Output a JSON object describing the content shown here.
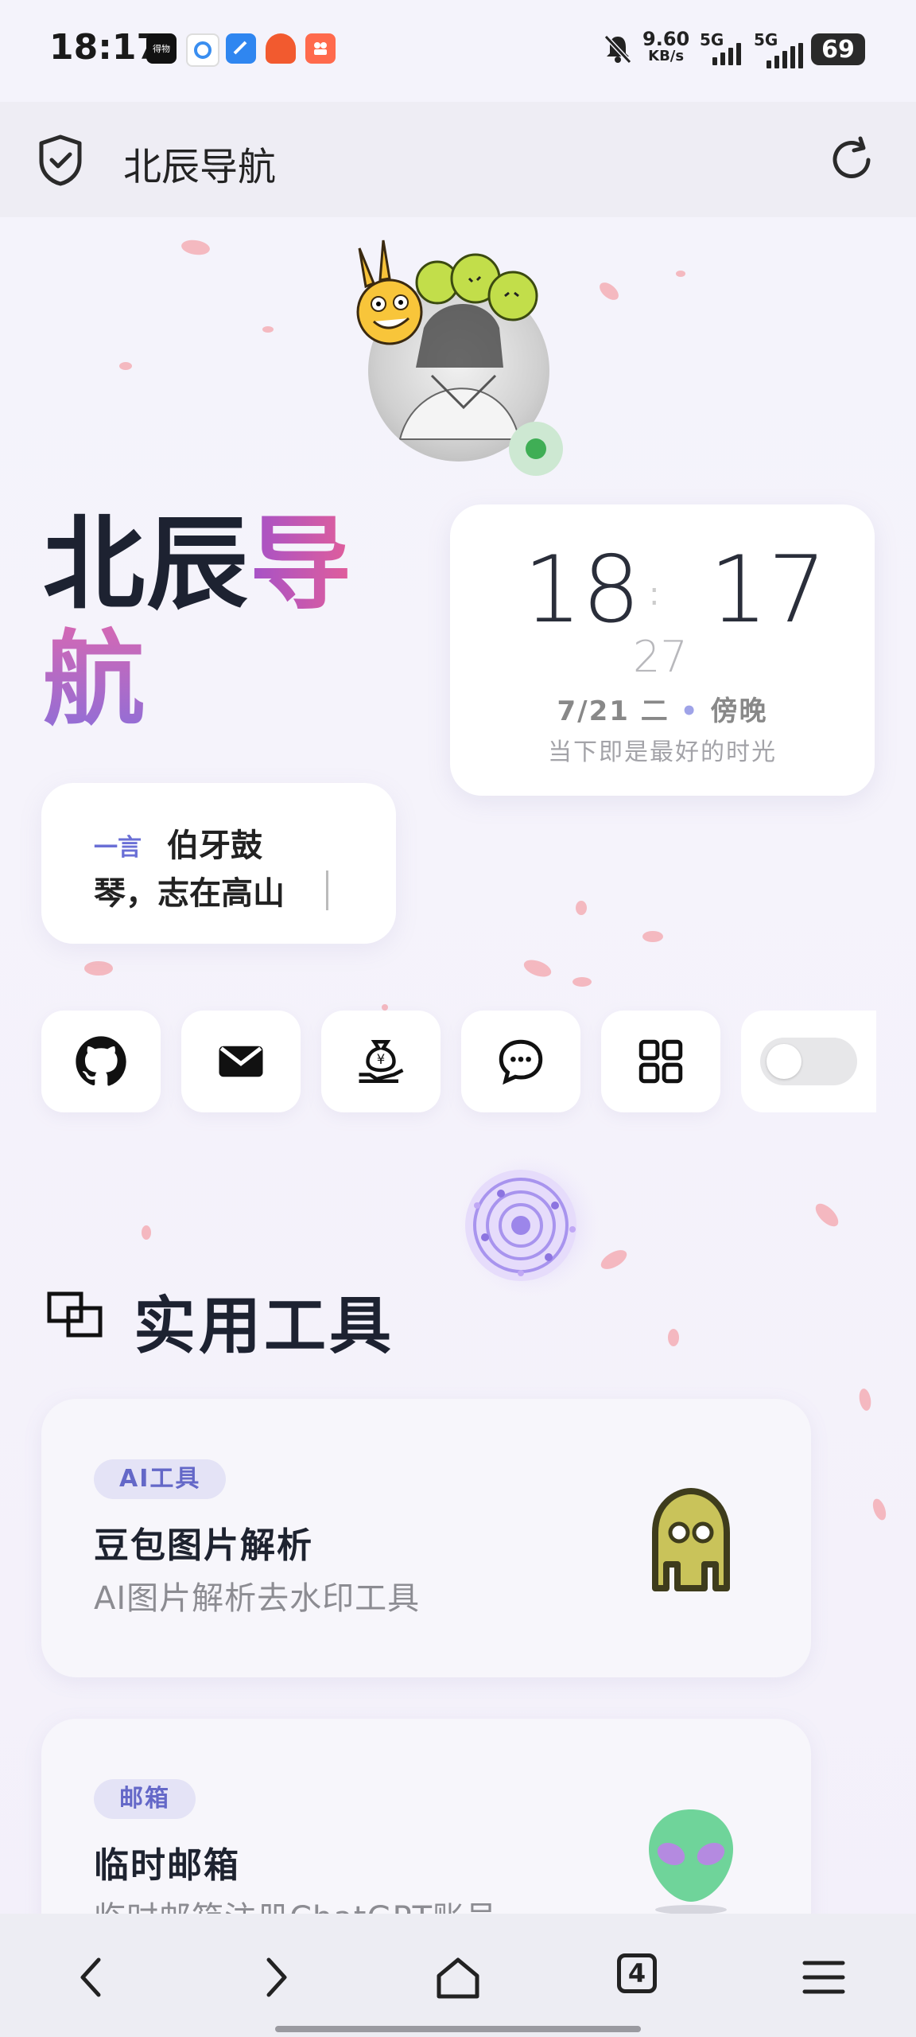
{
  "status_bar": {
    "time": "18:17",
    "app_icons": [
      "得物",
      "circle-app",
      "browser",
      "gift-app",
      "shop-app"
    ],
    "net_speed_value": "9.60",
    "net_speed_unit": "KB/s",
    "signal1_label": "5G",
    "signal2_label": "5G",
    "battery": "69"
  },
  "header": {
    "title": "北辰导航"
  },
  "brand": {
    "line1_part1": "北辰",
    "line1_part2": "导",
    "line2": "航"
  },
  "clock": {
    "hours": "18",
    "minutes": "17",
    "seconds": "27",
    "date": "7/21 二",
    "period": "傍晚",
    "motto": "当下即是最好的时光"
  },
  "quote": {
    "tag": "一言",
    "line1": "伯牙鼓",
    "line2": "琴，志在高山"
  },
  "quick_links": [
    "github-icon",
    "mail-icon",
    "donate-icon",
    "chat-icon",
    "apps-icon",
    "theme-toggle"
  ],
  "section": {
    "title": "实用工具"
  },
  "tools": [
    {
      "tag": "AI工具",
      "name": "豆包图片解析",
      "desc": "AI图片解析去水印工具",
      "icon": "ghost-icon"
    },
    {
      "tag": "邮箱",
      "name": "临时邮箱",
      "desc": "临时邮箱注册ChatGPT账号",
      "icon": "alien-icon"
    }
  ],
  "bottom_nav": {
    "tabs_count": "4"
  },
  "colors": {
    "accent": "#6a6fd6",
    "brand_gradient_start": "#a552c8",
    "brand_gradient_end": "#e25e9a",
    "online": "#3fae55"
  }
}
